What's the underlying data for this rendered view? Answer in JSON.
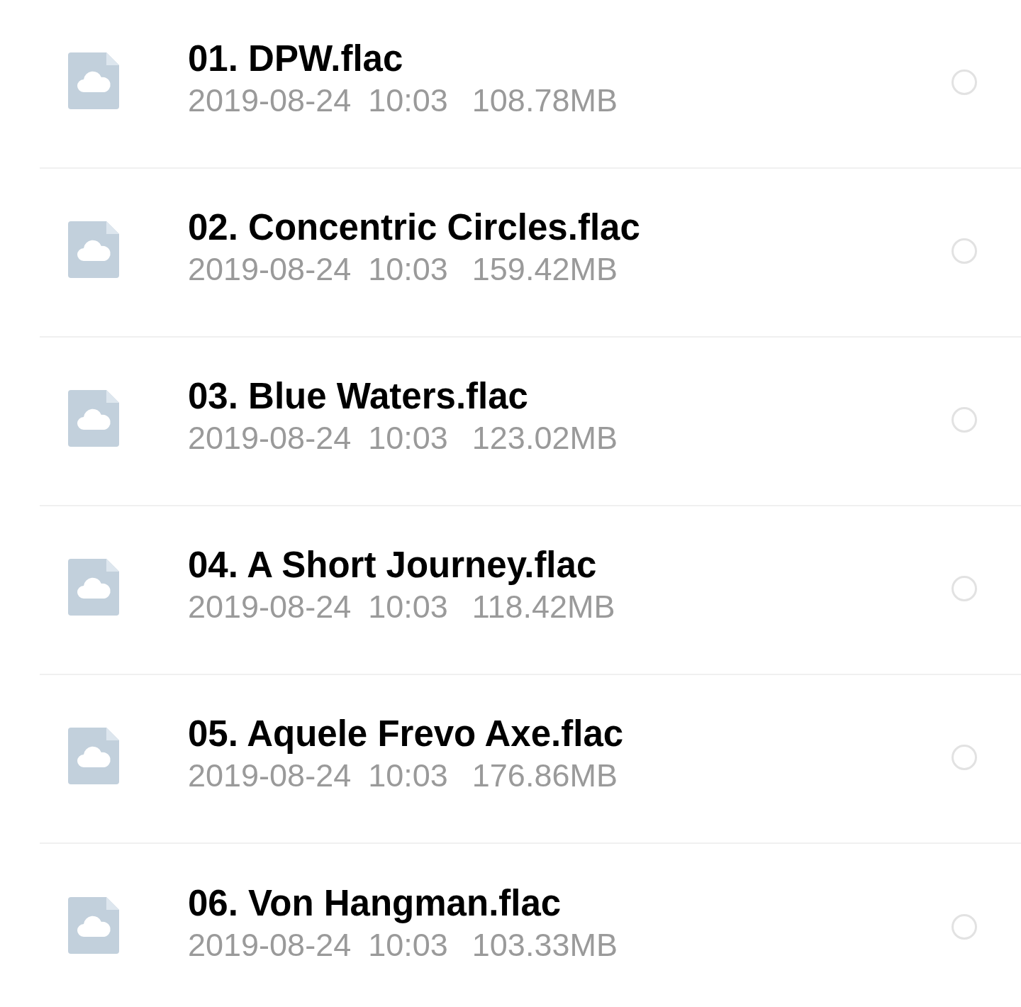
{
  "files": [
    {
      "name": "01. DPW.flac",
      "date": "2019-08-24",
      "time": "10:03",
      "size": "108.78MB",
      "selected": false
    },
    {
      "name": "02. Concentric Circles.flac",
      "date": "2019-08-24",
      "time": "10:03",
      "size": "159.42MB",
      "selected": false
    },
    {
      "name": "03. Blue Waters.flac",
      "date": "2019-08-24",
      "time": "10:03",
      "size": "123.02MB",
      "selected": false
    },
    {
      "name": "04. A Short Journey.flac",
      "date": "2019-08-24",
      "time": "10:03",
      "size": "118.42MB",
      "selected": false
    },
    {
      "name": "05. Aquele Frevo Axe.flac",
      "date": "2019-08-24",
      "time": "10:03",
      "size": "176.86MB",
      "selected": false
    },
    {
      "name": "06. Von Hangman.flac",
      "date": "2019-08-24",
      "time": "10:03",
      "size": "103.33MB",
      "selected": false
    }
  ]
}
